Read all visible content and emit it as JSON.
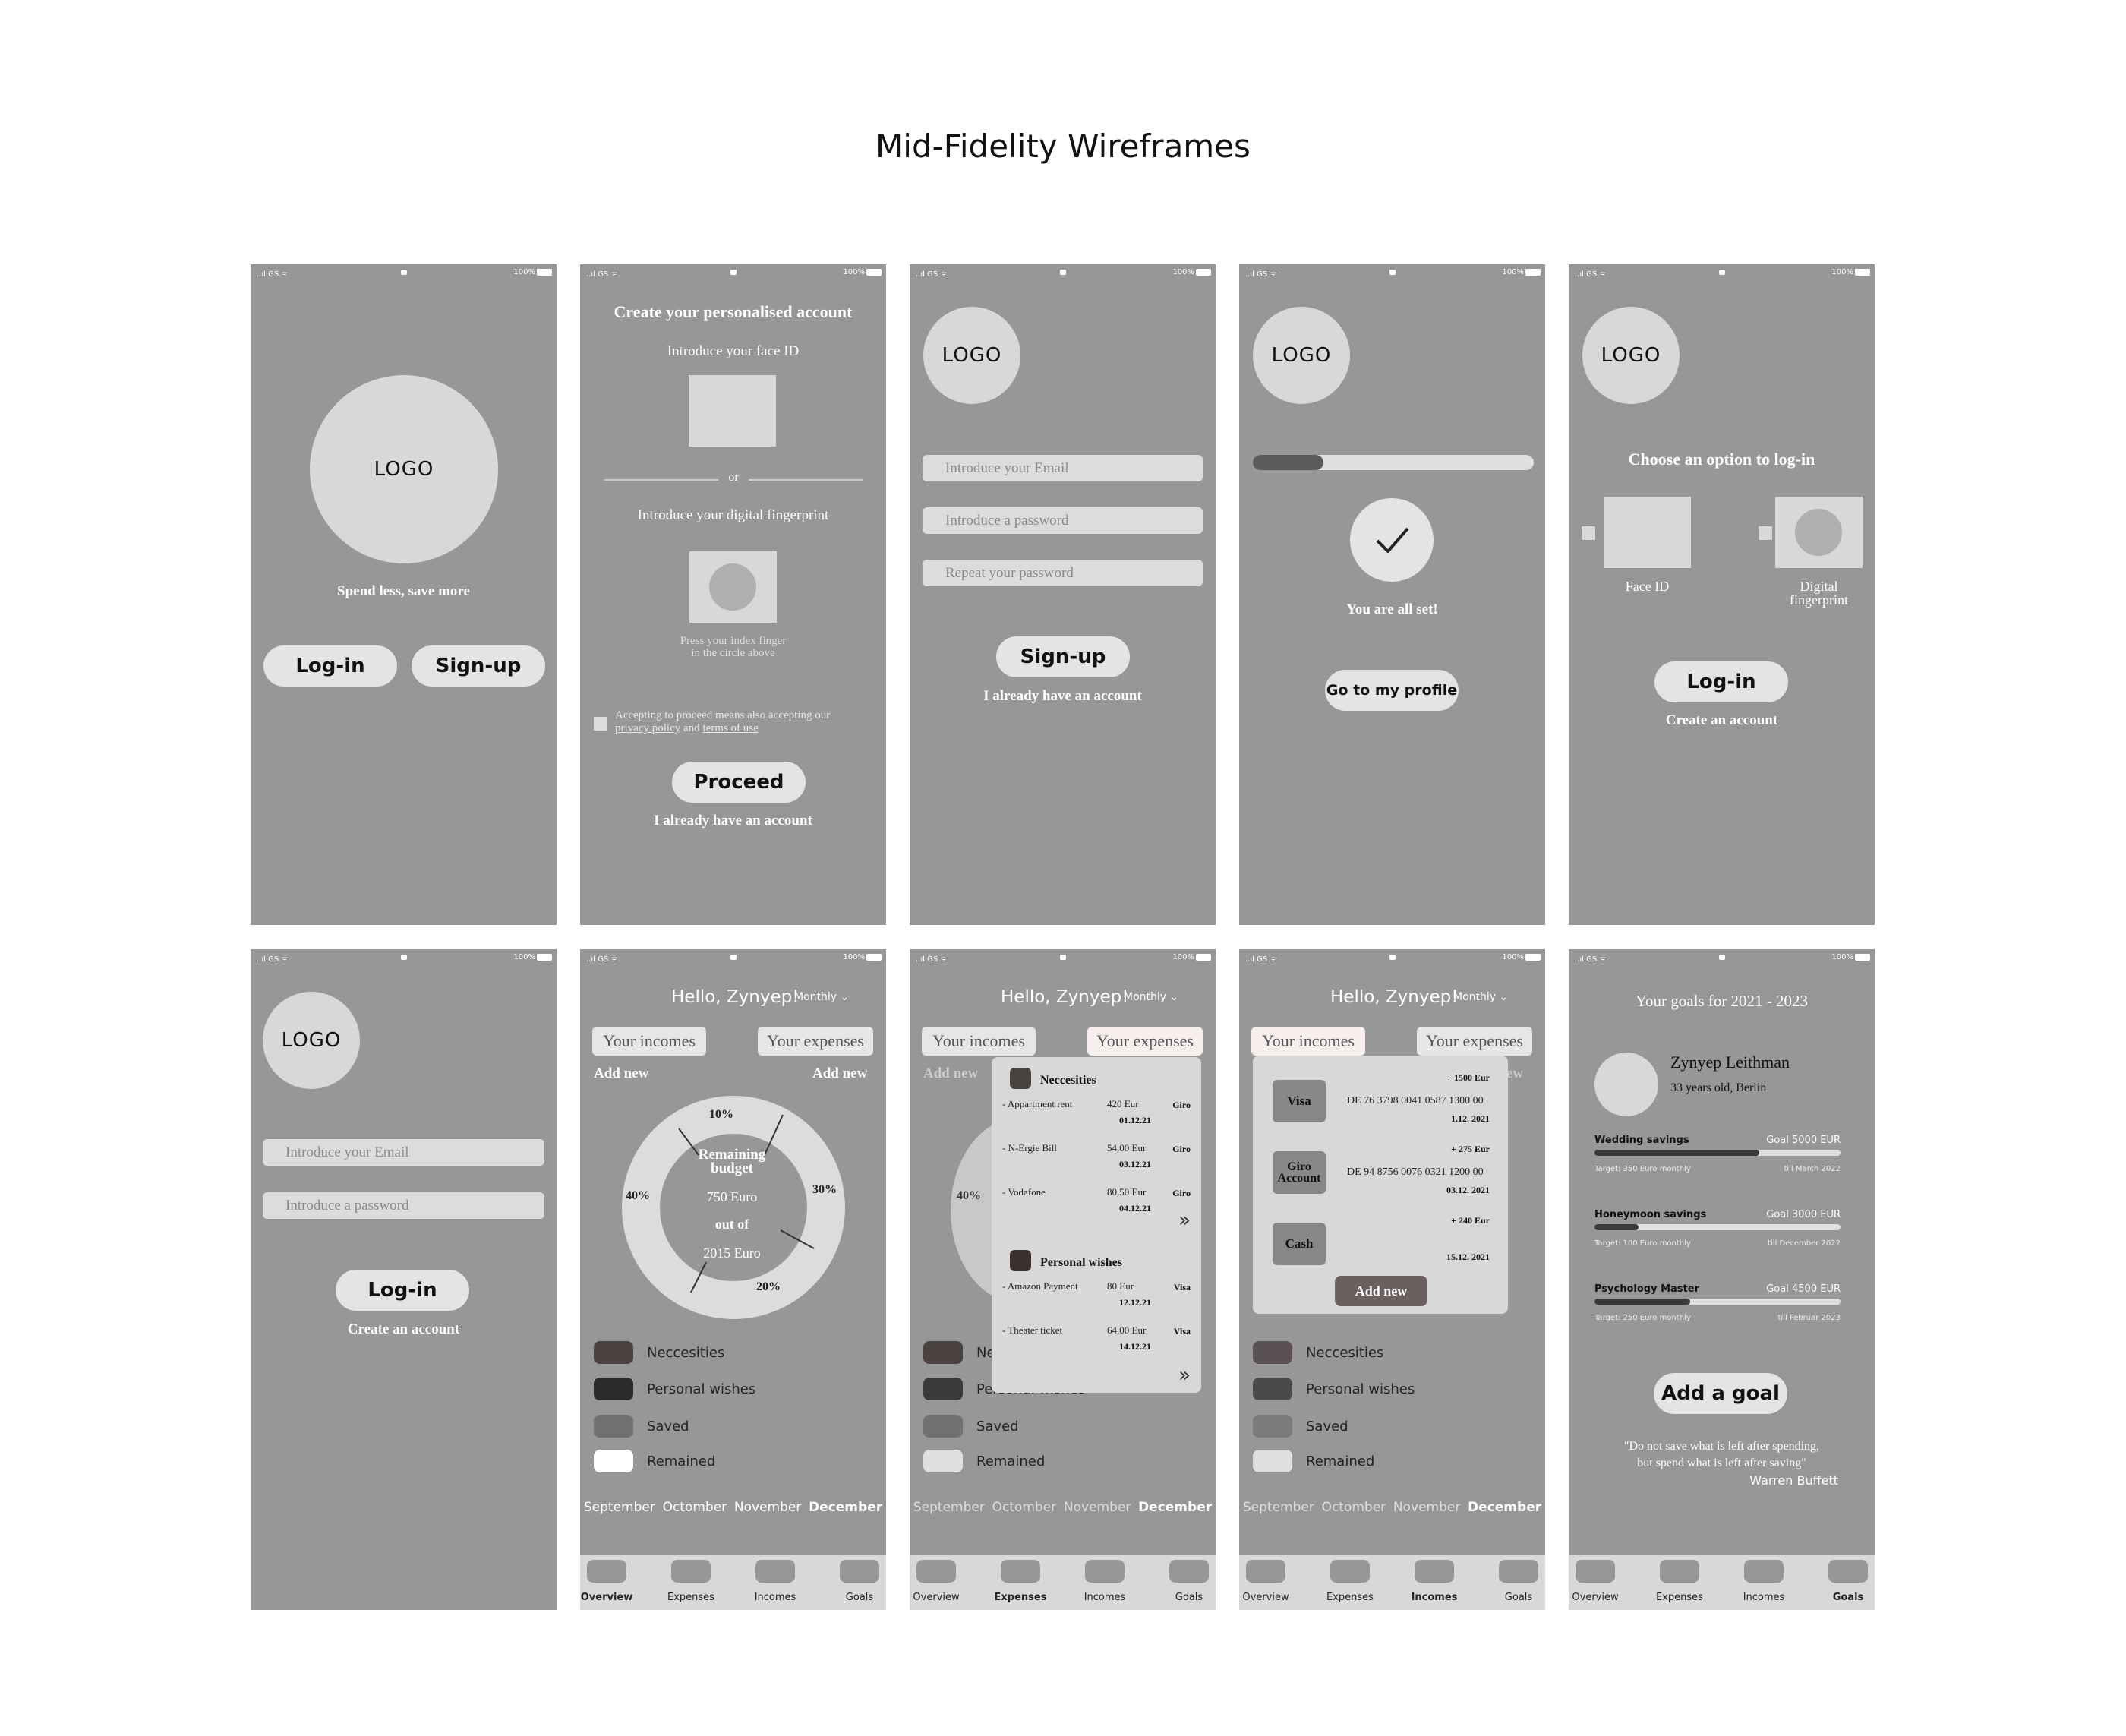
{
  "title": "Mid-Fidelity Wireframes",
  "status_bar": {
    "left": "..ıl GS ᯤ",
    "right": "100%"
  },
  "s1": {
    "logo": "LOGO",
    "tagline": "Spend less, save more",
    "login": "Log-in",
    "signup": "Sign-up"
  },
  "s2": {
    "heading": "Create your personalised account",
    "face_id": "Introduce your face ID",
    "or": "or",
    "fingerprint": "Introduce your digital fingerprint",
    "press1": "Press your index finger",
    "press2": "in the circle above",
    "accept1": "Accepting to proceed means also accepting our",
    "privacy": "privacy policy",
    "and": "and",
    "terms": "terms of use",
    "proceed": "Proceed",
    "have_account": "I already have an account"
  },
  "s3": {
    "logo": "LOGO",
    "email": "Introduce your Email",
    "password": "Introduce a password",
    "repeat": "Repeat your password",
    "signup": "Sign-up",
    "have_account": "I already have an account"
  },
  "s4": {
    "logo": "LOGO",
    "progress": 0.25,
    "all_set": "You are all set!",
    "profile": "Go to my profile"
  },
  "s5": {
    "logo": "LOGO",
    "choose": "Choose an option to log-in",
    "face_id": "Face ID",
    "digital": "Digital",
    "fingerprint": "fingerprint",
    "login": "Log-in",
    "create": "Create an account"
  },
  "s6": {
    "logo": "LOGO",
    "email": "Introduce your Email",
    "password": "Introduce a password",
    "login": "Log-in",
    "create": "Create an account"
  },
  "dash": {
    "hello": "Hello, Zynyep!",
    "monthly": "Monthly",
    "incomes": "Your incomes",
    "expenses": "Your expenses",
    "add_new": "Add new",
    "remaining": "Remaining",
    "budget": "budget",
    "amount": "750 Euro",
    "out_of": "out of",
    "total": "2015 Euro",
    "p10": "10%",
    "p40": "40%",
    "p30": "30%",
    "p20": "20%",
    "legend": [
      "Neccesities",
      "Personal wishes",
      "Saved",
      "Remained"
    ],
    "months": [
      "September",
      "Octomber",
      "November",
      "December"
    ],
    "nav": [
      "Overview",
      "Expenses",
      "Incomes",
      "Goals"
    ]
  },
  "colors": {
    "neccesities": "#4a4141",
    "personal": "#2a2a2a",
    "saved": "#707070",
    "remained": "#ffffff",
    "screen": "#979797"
  },
  "exp_popup": {
    "cat1": "Neccesities",
    "rows1": [
      {
        "name": "- Appartment rent",
        "amt": "420 Eur",
        "type": "Giro",
        "date": "01.12.21"
      },
      {
        "name": "- N-Ergie Bill",
        "amt": "54,00 Eur",
        "type": "Giro",
        "date": "03.12.21"
      },
      {
        "name": "- Vodafone",
        "amt": "80,50 Eur",
        "type": "Giro",
        "date": "04.12.21"
      }
    ],
    "cat2": "Personal wishes",
    "rows2": [
      {
        "name": "- Amazon Payment",
        "amt": "80 Eur",
        "type": "Visa",
        "date": "12.12.21"
      },
      {
        "name": "- Theater ticket",
        "amt": "64,00 Eur",
        "type": "Visa",
        "date": "14.12.21"
      }
    ],
    "more": "»",
    "behind_ne": "Ne",
    "behind_pw": "Personal wishes"
  },
  "inc_popup": {
    "rows": [
      {
        "label": "Visa",
        "iban": "DE 76 3798 0041 0587 1300 00",
        "amt": "+ 1500 Eur",
        "date": "1.12. 2021"
      },
      {
        "label1": "Giro",
        "label2": "Account",
        "iban": "DE 94 8756 0076 0321 1200 00",
        "amt": "+ 275 Eur",
        "date": "03.12. 2021"
      },
      {
        "label": "Cash",
        "iban": "",
        "amt": "+ 240 Eur",
        "date": "15.12. 2021"
      }
    ],
    "add_new": "Add new",
    "behind": "ew"
  },
  "goals": {
    "heading": "Your goals for 2021 - 2023",
    "name": "Zynyep Leithman",
    "info": "33 years old, Berlin",
    "items": [
      {
        "name": "Wedding savings",
        "goal": "Goal 5000 EUR",
        "target": "Target: 350 Euro monthly",
        "till": "till March 2022",
        "progress": 0.67
      },
      {
        "name": "Honeymoon savings",
        "goal": "Goal 3000 EUR",
        "target": "Target: 100 Euro monthly",
        "till": "till December 2022",
        "progress": 0.18
      },
      {
        "name": "Psychology Master",
        "goal": "Goal 4500 EUR",
        "target": "Target: 250 Euro monthly",
        "till": "till Februar 2023",
        "progress": 0.39
      }
    ],
    "add_goal": "Add a goal",
    "quote1": "\"Do not save what is left after spending,",
    "quote2": "but spend what is left after saving\"",
    "author": "Warren Buffett"
  }
}
